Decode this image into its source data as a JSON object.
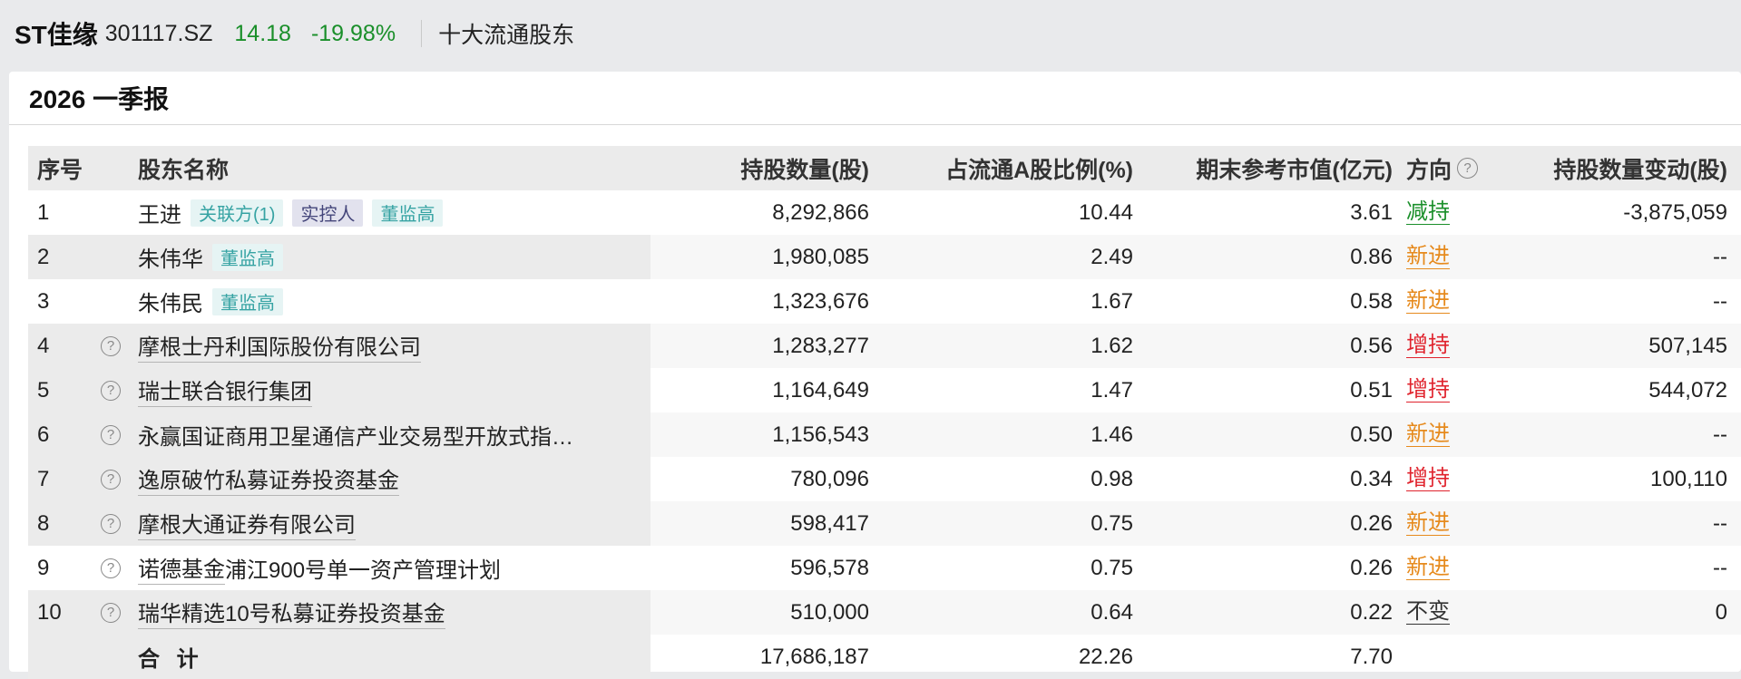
{
  "stock": {
    "name": "ST佳缘",
    "code": "301117.SZ",
    "price": "14.18",
    "change_pct": "-19.98%",
    "section": "十大流通股东"
  },
  "report": {
    "title": "2026 一季报"
  },
  "table": {
    "headers": {
      "index": "序号",
      "name": "股东名称",
      "holding": "持股数量(股)",
      "ratio": "占流通A股比例(%)",
      "value": "期末参考市值(亿元)",
      "direction": "方向",
      "change": "持股数量变动(股)"
    },
    "rows": [
      {
        "index": "1",
        "name": "王进",
        "tags": [
          "关联方(1)",
          "实控人",
          "董监高"
        ],
        "holding": "8,292,866",
        "ratio": "10.44",
        "value": "3.61",
        "direction": "减持",
        "change": "-3,875,059"
      },
      {
        "index": "2",
        "name": "朱伟华",
        "tags": [
          "董监高"
        ],
        "holding": "1,980,085",
        "ratio": "2.49",
        "value": "0.86",
        "direction": "新进",
        "change": "--"
      },
      {
        "index": "3",
        "name": "朱伟民",
        "tags": [
          "董监高"
        ],
        "holding": "1,323,676",
        "ratio": "1.67",
        "value": "0.58",
        "direction": "新进",
        "change": "--"
      },
      {
        "index": "4",
        "name": "摩根士丹利国际股份有限公司",
        "holding": "1,283,277",
        "ratio": "1.62",
        "value": "0.56",
        "direction": "增持",
        "change": "507,145"
      },
      {
        "index": "5",
        "name": "瑞士联合银行集团",
        "holding": "1,164,649",
        "ratio": "1.47",
        "value": "0.51",
        "direction": "增持",
        "change": "544,072"
      },
      {
        "index": "6",
        "name": "永赢国证商用卫星通信产业交易型开放式指…",
        "holding": "1,156,543",
        "ratio": "1.46",
        "value": "0.50",
        "direction": "新进",
        "change": "--"
      },
      {
        "index": "7",
        "name": "逸原破竹私募证券投资基金",
        "holding": "780,096",
        "ratio": "0.98",
        "value": "0.34",
        "direction": "增持",
        "change": "100,110"
      },
      {
        "index": "8",
        "name": "摩根大通证券有限公司",
        "holding": "598,417",
        "ratio": "0.75",
        "value": "0.26",
        "direction": "新进",
        "change": "--"
      },
      {
        "index": "9",
        "name_part1": "诺德基金",
        "name_part2": "浦江900号单一资产管理计划",
        "holding": "596,578",
        "ratio": "0.75",
        "value": "0.26",
        "direction": "新进",
        "change": "--"
      },
      {
        "index": "10",
        "name": "瑞华精选10号私募证券投资基金",
        "holding": "510,000",
        "ratio": "0.64",
        "value": "0.22",
        "direction": "不变",
        "change": "0"
      }
    ],
    "total": {
      "label": "合 计",
      "holding": "17,686,187",
      "ratio": "22.26",
      "value": "7.70"
    }
  },
  "colors": {
    "green": "#1a8f2a",
    "red": "#e0232d",
    "orange": "#e68a1d",
    "teal": "#36a3a3"
  },
  "icons": {
    "help": "question-circle-icon"
  }
}
